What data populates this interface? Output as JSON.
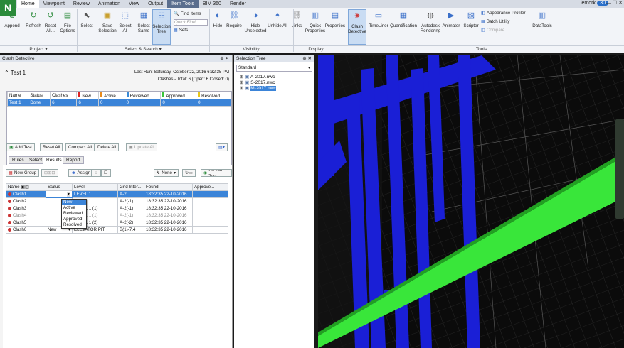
{
  "app": {
    "logo_letter": "N",
    "user": "lemork",
    "badge": "30",
    "window_controls": "— ☐ ✕"
  },
  "menu_tabs": [
    "Home",
    "Viewpoint",
    "Review",
    "Animation",
    "View",
    "Output",
    "Item Tools",
    "BIM 360",
    "Render"
  ],
  "ribbon": {
    "buttons": [
      {
        "label": "Append",
        "icon": "append-icon"
      },
      {
        "label": "Refresh",
        "icon": "refresh-icon"
      },
      {
        "label": "Reset All...",
        "icon": "reset-icon"
      },
      {
        "label": "File Options",
        "icon": "file-options-icon"
      },
      {
        "label": "Select",
        "icon": "select-icon"
      },
      {
        "label": "Save Selection",
        "icon": "save-selection-icon"
      },
      {
        "label": "Select All",
        "icon": "select-all-icon"
      },
      {
        "label": "Select Same",
        "icon": "select-same-icon"
      },
      {
        "label": "Selection Tree",
        "icon": "selection-tree-icon"
      },
      {
        "label": "Hide",
        "icon": "hide-icon"
      },
      {
        "label": "Require",
        "icon": "require-icon"
      },
      {
        "label": "Hide Unselected",
        "icon": "hide-unselected-icon"
      },
      {
        "label": "Unhide All",
        "icon": "unhide-all-icon"
      },
      {
        "label": "Links",
        "icon": "links-icon"
      },
      {
        "label": "Quick Properties",
        "icon": "quick-properties-icon"
      },
      {
        "label": "Properties",
        "icon": "properties-icon"
      },
      {
        "label": "Clash Detective",
        "icon": "clash-detective-icon"
      },
      {
        "label": "TimeLiner",
        "icon": "timeliner-icon"
      },
      {
        "label": "Quantification",
        "icon": "quantification-icon"
      },
      {
        "label": "Autodesk Rendering",
        "icon": "rendering-icon"
      },
      {
        "label": "Animator",
        "icon": "animator-icon"
      },
      {
        "label": "Scripter",
        "icon": "scripter-icon"
      },
      {
        "label": "DataTools",
        "icon": "datatools-icon"
      }
    ],
    "find_items": "Find Items",
    "quick_find_placeholder": "Quick Find",
    "sets": "Sets",
    "appearance_profiler": "Appearance Profiler",
    "batch_utility": "Batch Utility",
    "compare": "Compare",
    "groups": [
      "Project ▾",
      "Select & Search ▾",
      "Visibility",
      "Display",
      "Tools"
    ]
  },
  "clash": {
    "panel_title": "Clash Detective",
    "test_name": "Test 1",
    "last_run": "Last Run:  Saturday, October 22, 2016 6:32:35 PM",
    "summary": "Clashes - Total:  6  (Open:  6  Closed:  0)",
    "tests_headers": [
      "Name",
      "Status",
      "Clashes",
      "New",
      "Active",
      "Reviewed",
      "Approved",
      "Resolved"
    ],
    "tests_row": [
      "Test 1",
      "Done",
      "6",
      "6",
      "0",
      "0",
      "0",
      "0"
    ],
    "add_test": "Add Test",
    "reset_all": "Reset All",
    "compact_all": "Compact All",
    "delete_all": "Delete All",
    "update_all": "Update All",
    "tabs": [
      "Rules",
      "Select",
      "Results",
      "Report"
    ],
    "new_group": "New Group",
    "assign": "Assign",
    "none": "None",
    "rerun": "Re-run Test",
    "results_headers": [
      "Name",
      "Status",
      "Level",
      "Grid Inter...",
      "Found",
      "Approve..."
    ],
    "results": [
      {
        "name": "Clash1",
        "status": "",
        "level": "LEVEL 1",
        "grid": "A-2",
        "found": "18:32:35 22-10-2016"
      },
      {
        "name": "Clash2",
        "status": "",
        "level": "LEVEL 1",
        "grid": "A-2(-1)",
        "found": "18:32:35 22-10-2016"
      },
      {
        "name": "Clash3",
        "status": "",
        "level": "LEVEL 1 (1)",
        "grid": "A-2(-1)",
        "found": "18:32:35 22-10-2016"
      },
      {
        "name": "Clash4",
        "status": "",
        "level": "LEVEL 1 (1)",
        "grid": "A-2(-1)",
        "found": "18:32:35 22-10-2016"
      },
      {
        "name": "Clash5",
        "status": "",
        "level": "LEVEL 1 (2)",
        "grid": "A-2(-2)",
        "found": "18:32:35 22-10-2016"
      },
      {
        "name": "Clash6",
        "status": "New",
        "level": "ELEVATOR PIT",
        "grid": "B(1)-7.4",
        "found": "18:32:35 22-10-2016"
      }
    ],
    "status_options": [
      "New",
      "Active",
      "Reviewed",
      "Approved",
      "Resolved"
    ]
  },
  "seltree": {
    "title": "Selection Tree",
    "mode": "Standard",
    "items": [
      "A-2017.nwc",
      "S-2017.nwc",
      "M-2017.nwc"
    ]
  },
  "colors": {
    "blue_pipe": "#1a1fd6",
    "green_beam": "#39e63a",
    "selection": "#3b84d8"
  }
}
